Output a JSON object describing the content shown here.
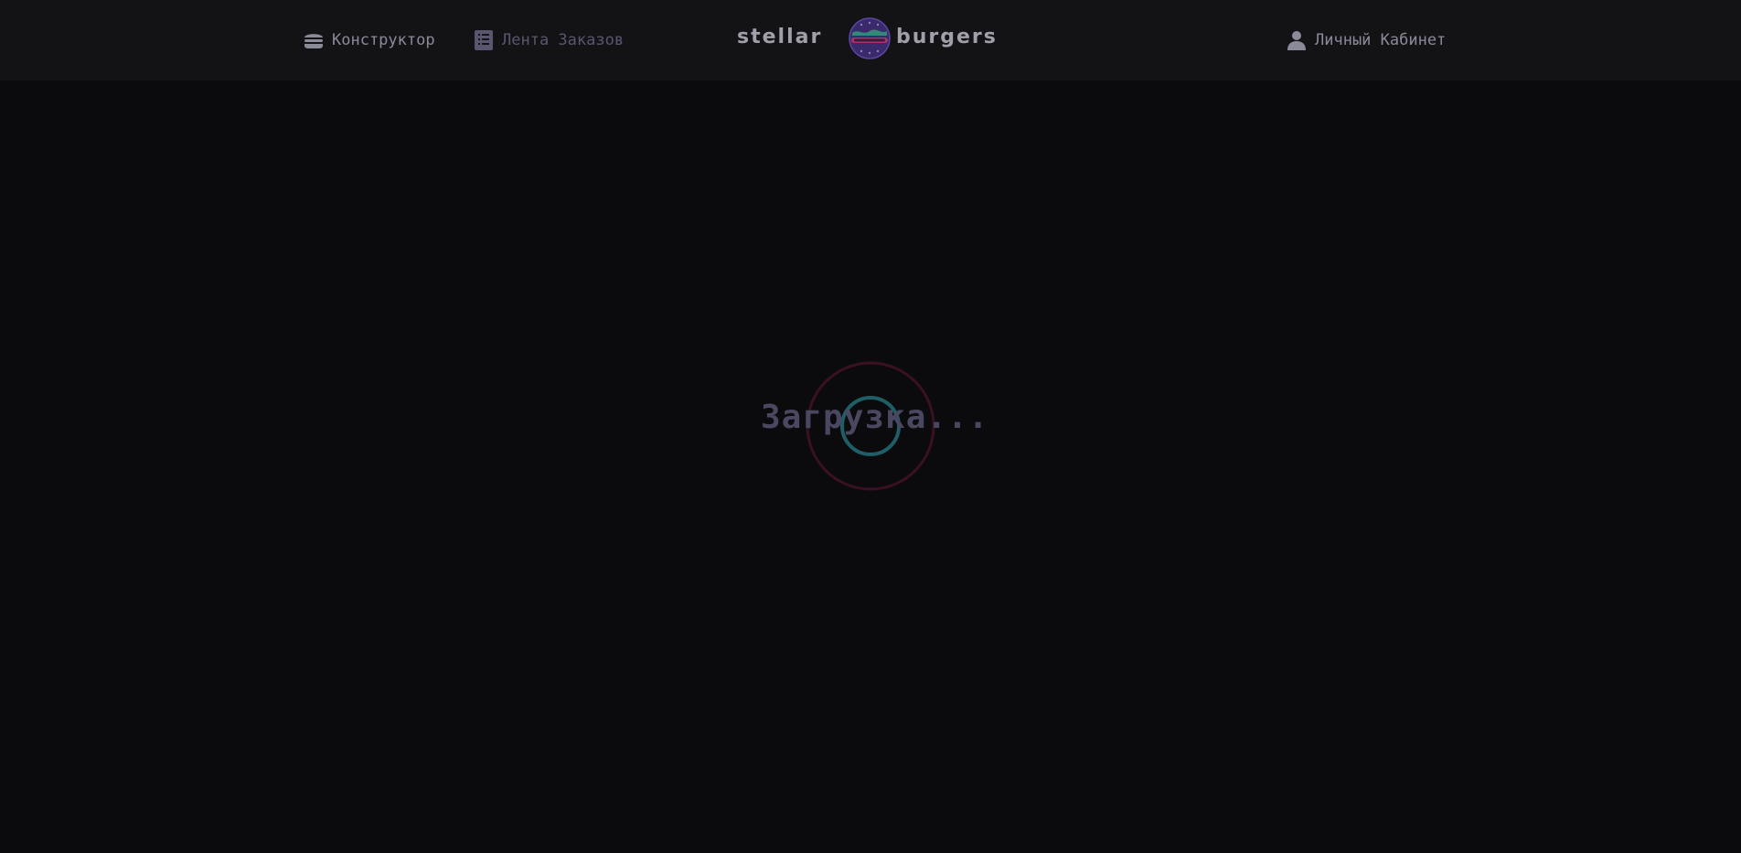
{
  "header": {
    "nav": {
      "constructor_label": "Конструктор",
      "feed_label": "Лента Заказов",
      "account_label": "Личный Кабинет"
    },
    "logo": {
      "left_text": "stellar",
      "right_text": "burgers"
    }
  },
  "main": {
    "loading_text": "Загрузка..."
  },
  "colors": {
    "header_bg": "#131316",
    "page_bg": "#0b0b0d",
    "spinner_outer": "#4c1630",
    "spinner_inner": "#1f5e66",
    "text_muted": "#8a8a99"
  },
  "icons": {
    "constructor": "burger-icon",
    "feed": "list-icon",
    "account": "profile-icon"
  }
}
